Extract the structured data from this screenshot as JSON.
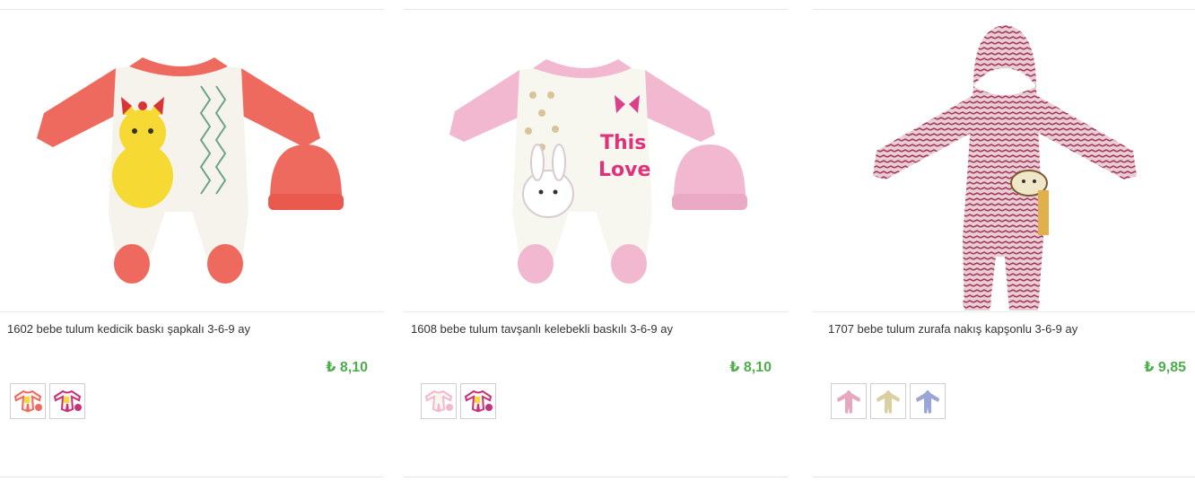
{
  "colors": {
    "price": "#4cae4c",
    "title": "#333333",
    "border": "#e6e6e6",
    "coral": "#ef6a5e",
    "pink": "#f2b8d0",
    "maroon": "#a83a5c"
  },
  "products": [
    {
      "title": "1602 bebe tulum kedicik baskı şapkalı 3-6-9 ay",
      "price": "₺ 8,10",
      "image": "coral-kitten-romper-with-hat",
      "variants": [
        "coral",
        "magenta"
      ]
    },
    {
      "title": "1608 bebe tulum tavşanlı kelebekli baskılı 3-6-9 ay",
      "price": "₺ 8,10",
      "image": "pink-bunny-romper-with-hat",
      "variants": [
        "pink",
        "magenta"
      ]
    },
    {
      "title": "1707 bebe tulum zurafa nakış kapşonlu 3-6-9 ay",
      "price": "₺ 9,85",
      "image": "maroon-giraffe-hooded-romper",
      "variants": [
        "pink",
        "beige",
        "blue"
      ]
    }
  ]
}
